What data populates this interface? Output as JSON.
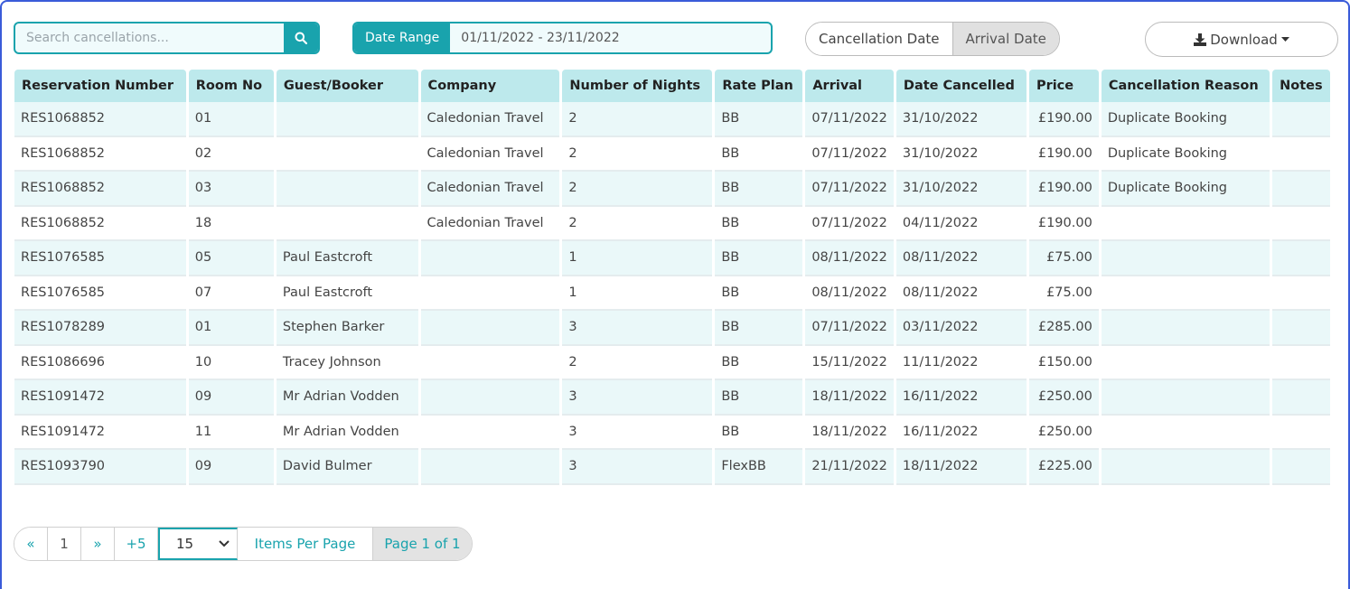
{
  "search": {
    "placeholder": "Search cancellations..."
  },
  "date_range": {
    "label": "Date Range",
    "value": "01/11/2022 - 23/11/2022"
  },
  "date_toggle": {
    "options": [
      "Cancellation Date",
      "Arrival Date"
    ],
    "active": "Arrival Date"
  },
  "download": {
    "label": "Download"
  },
  "table": {
    "headers": [
      "Reservation Number",
      "Room No",
      "Guest/Booker",
      "Company",
      "Number of Nights",
      "Rate Plan",
      "Arrival",
      "Date Cancelled",
      "Price",
      "Cancellation Reason",
      "Notes"
    ],
    "rows": [
      [
        "RES1068852",
        "01",
        "",
        "Caledonian Travel",
        "2",
        "BB",
        "07/11/2022",
        "31/10/2022",
        "£190.00",
        "Duplicate Booking",
        ""
      ],
      [
        "RES1068852",
        "02",
        "",
        "Caledonian Travel",
        "2",
        "BB",
        "07/11/2022",
        "31/10/2022",
        "£190.00",
        "Duplicate Booking",
        ""
      ],
      [
        "RES1068852",
        "03",
        "",
        "Caledonian Travel",
        "2",
        "BB",
        "07/11/2022",
        "31/10/2022",
        "£190.00",
        "Duplicate Booking",
        ""
      ],
      [
        "RES1068852",
        "18",
        "",
        "Caledonian Travel",
        "2",
        "BB",
        "07/11/2022",
        "04/11/2022",
        "£190.00",
        "",
        ""
      ],
      [
        "RES1076585",
        "05",
        "Paul Eastcroft",
        "",
        "1",
        "BB",
        "08/11/2022",
        "08/11/2022",
        "£75.00",
        "",
        ""
      ],
      [
        "RES1076585",
        "07",
        "Paul Eastcroft",
        "",
        "1",
        "BB",
        "08/11/2022",
        "08/11/2022",
        "£75.00",
        "",
        ""
      ],
      [
        "RES1078289",
        "01",
        "Stephen Barker",
        "",
        "3",
        "BB",
        "07/11/2022",
        "03/11/2022",
        "£285.00",
        "",
        ""
      ],
      [
        "RES1086696",
        "10",
        "Tracey Johnson",
        "",
        "2",
        "BB",
        "15/11/2022",
        "11/11/2022",
        "£150.00",
        "",
        ""
      ],
      [
        "RES1091472",
        "09",
        "Mr Adrian Vodden",
        "",
        "3",
        "BB",
        "18/11/2022",
        "16/11/2022",
        "£250.00",
        "",
        ""
      ],
      [
        "RES1091472",
        "11",
        "Mr Adrian Vodden",
        "",
        "3",
        "BB",
        "18/11/2022",
        "16/11/2022",
        "£250.00",
        "",
        ""
      ],
      [
        "RES1093790",
        "09",
        "David Bulmer",
        "",
        "3",
        "FlexBB",
        "21/11/2022",
        "18/11/2022",
        "£225.00",
        "",
        ""
      ]
    ]
  },
  "pagination": {
    "prev": "«",
    "page_number": "1",
    "next": "»",
    "more": "+5",
    "per_page_value": "15",
    "per_page_label": "Items Per Page",
    "page_info": "Page 1 of 1"
  },
  "colors": {
    "accent": "#19a3ad",
    "header_bg": "#bde9ec",
    "row_alt": "#eaf8f9",
    "frame": "#3a5bd9"
  }
}
